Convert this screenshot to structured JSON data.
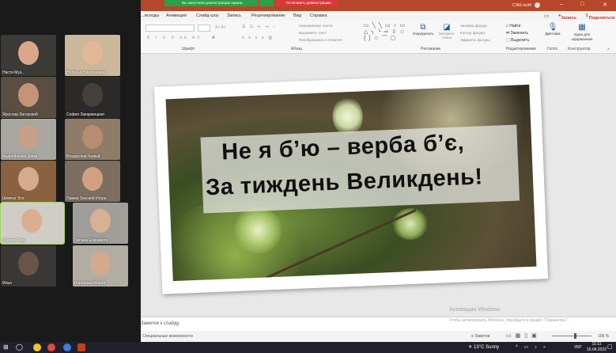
{
  "participants": [
    {
      "name": "Настя Муз..."
    },
    {
      "name": "Наталья Николаевна"
    },
    {
      "name": "Ярослав Загорский"
    },
    {
      "name": "София Закаржецкая"
    },
    {
      "name": "Андрейченко Дима"
    },
    {
      "name": "Владислав Чалый"
    },
    {
      "name": "Шевчук Эсо"
    },
    {
      "name": "Прима Занский Игорь"
    },
    {
      "name": "Корнев Гера"
    },
    {
      "name": "Оксана Елизавета"
    },
    {
      "name": "Илья"
    },
    {
      "name": "Воронова Мария"
    }
  ],
  "sharing_bar": {
    "status": "Вы запустили демонстрацию экрана",
    "stop": "Остановить демонстрацию"
  },
  "window": {
    "title": "СЭШ №94",
    "date_label": "15.04.2022",
    "record": "Запись",
    "share": "Поделиться"
  },
  "tabs": [
    "...исходы",
    "Анимация",
    "Слайд-шоу",
    "Запись",
    "Рецензирование",
    "Вид",
    "Справка"
  ],
  "ribbon": {
    "groups": [
      "Шрифт",
      "Абзац",
      "Рисование",
      "Редактирование",
      "Голос",
      "Конструктор"
    ],
    "items": {
      "text_direction": "Направление текста",
      "align_text": "Выровнять текст",
      "smartart": "Преобразовать в SmartArt",
      "arrange": "Упорядочить",
      "quick_styles": "Экспресс-стили",
      "fill": "Заливка фигуры",
      "outline": "Контур фигуры",
      "effects": "Эффекты фигуры",
      "find": "Найти",
      "replace": "Заменить",
      "select": "Выделить",
      "dictate": "Диктовка",
      "designer": "Идеи для оформления"
    }
  },
  "slide": {
    "line1": "Не я б’ю – верба б’є,",
    "line2": "За тиждень Великдень!"
  },
  "notes": {
    "placeholder": "Заметки к слайду"
  },
  "status": {
    "accessibility": "Специальные возможности",
    "notes_btn": "Заметки",
    "zoom": "106 %"
  },
  "activate": {
    "title": "Активация Windows",
    "subtitle": "Чтобы активировать Windows, перейдите в раздел \"Параметры\"."
  },
  "taskbar": {
    "weather": "13°C Sunny",
    "lang": "УКР",
    "time": "11:11",
    "date": "15.04.2022"
  },
  "colors": {
    "accent": "#b7472a",
    "share_green": "#2e9e48",
    "share_red": "#d63b3b"
  }
}
